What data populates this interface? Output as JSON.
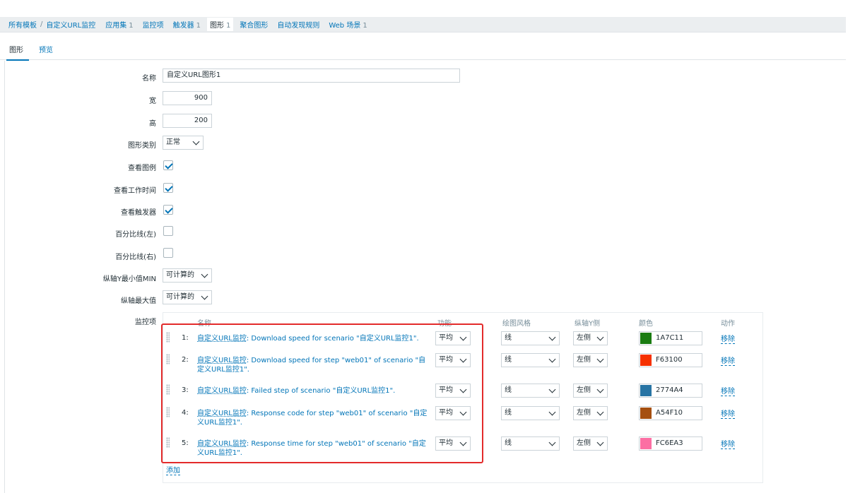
{
  "breadcrumb": {
    "root": "所有模板",
    "template": "自定义URL监控",
    "items": [
      {
        "label": "应用集",
        "count": "1"
      },
      {
        "label": "监控项",
        "count": ""
      },
      {
        "label": "触发器",
        "count": "1"
      },
      {
        "label": "图形",
        "count": "1"
      },
      {
        "label": "聚合图形",
        "count": ""
      },
      {
        "label": "自动发现规则",
        "count": ""
      },
      {
        "label": "Web 场景",
        "count": "1"
      }
    ]
  },
  "tabs": [
    "图形",
    "预览"
  ],
  "form": {
    "name_label": "名称",
    "name_value": "自定义URL图形1",
    "width_label": "宽",
    "width_value": "900",
    "height_label": "高",
    "height_value": "200",
    "graph_type_label": "图形类别",
    "graph_type_value": "正常",
    "show_legend_label": "查看图例",
    "show_worktime_label": "查看工作时间",
    "show_triggers_label": "查看触发器",
    "percentile_left_label": "百分比线(左)",
    "percentile_right_label": "百分比线(右)",
    "ymin_label": "纵轴Y最小值MIN",
    "ymin_value": "可计算的",
    "ymax_label": "纵轴最大值",
    "ymax_value": "可计算的",
    "items_label": "监控项"
  },
  "checks": {
    "show_legend": true,
    "show_worktime": true,
    "show_triggers": true,
    "percentile_left": false,
    "percentile_right": false
  },
  "items_table": {
    "headers": {
      "name": "名称",
      "function": "功能",
      "draw_style": "绘图风格",
      "y_axis": "纵轴Y侧",
      "color": "颜色",
      "action": "动作"
    },
    "rows": [
      {
        "idx": "1:",
        "host": "自定义URL监控",
        "text": ": Download speed for scenario \"自定义URL监控1\".",
        "function": "平均",
        "draw_style": "线",
        "y_axis": "左侧",
        "color": "1A7C11",
        "hex": "#1A7C11",
        "action": "移除"
      },
      {
        "idx": "2:",
        "host": "自定义URL监控",
        "text": ": Download speed for step \"web01\" of scenario \"自定义URL监控1\".",
        "function": "平均",
        "draw_style": "线",
        "y_axis": "左侧",
        "color": "F63100",
        "hex": "#F63100",
        "action": "移除"
      },
      {
        "idx": "3:",
        "host": "自定义URL监控",
        "text": ": Failed step of scenario \"自定义URL监控1\".",
        "function": "平均",
        "draw_style": "线",
        "y_axis": "左侧",
        "color": "2774A4",
        "hex": "#2774A4",
        "action": "移除"
      },
      {
        "idx": "4:",
        "host": "自定义URL监控",
        "text": ": Response code for step \"web01\" of scenario \"自定义URL监控1\".",
        "function": "平均",
        "draw_style": "线",
        "y_axis": "左侧",
        "color": "A54F10",
        "hex": "#A54F10",
        "action": "移除"
      },
      {
        "idx": "5:",
        "host": "自定义URL监控",
        "text": ": Response time for step \"web01\" of scenario \"自定义URL监控1\".",
        "function": "平均",
        "draw_style": "线",
        "y_axis": "左侧",
        "color": "FC6EA3",
        "hex": "#FC6EA3",
        "action": "移除"
      }
    ],
    "add": "添加"
  }
}
